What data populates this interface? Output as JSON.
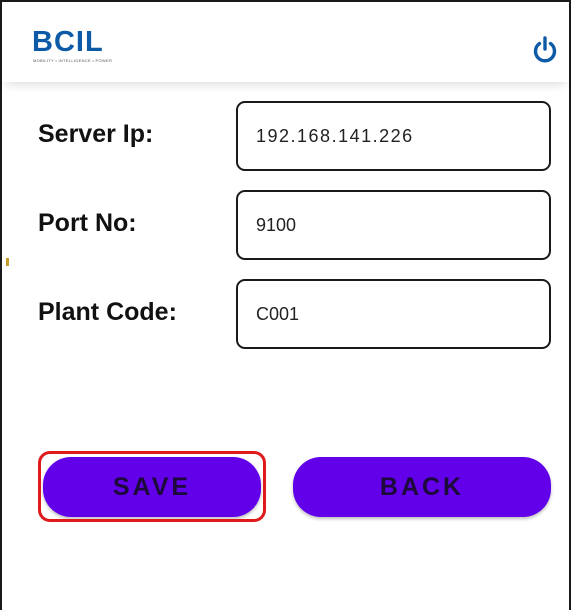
{
  "header": {
    "logo_text": "BCIL",
    "logo_tagline": "MOBILITY • INTELLIGENCE • POWER",
    "power_icon": "power-icon"
  },
  "form": {
    "server_ip": {
      "label": "Server Ip:",
      "value": "192.168.141.226"
    },
    "port_no": {
      "label": "Port No:",
      "value": "9100"
    },
    "plant_code": {
      "label": "Plant Code:",
      "value": "C001"
    }
  },
  "buttons": {
    "save_label": "SAVE",
    "back_label": "BACK"
  },
  "colors": {
    "brand": "#0d5aa7",
    "button": "#6200ea",
    "highlight": "#e01a1a"
  }
}
